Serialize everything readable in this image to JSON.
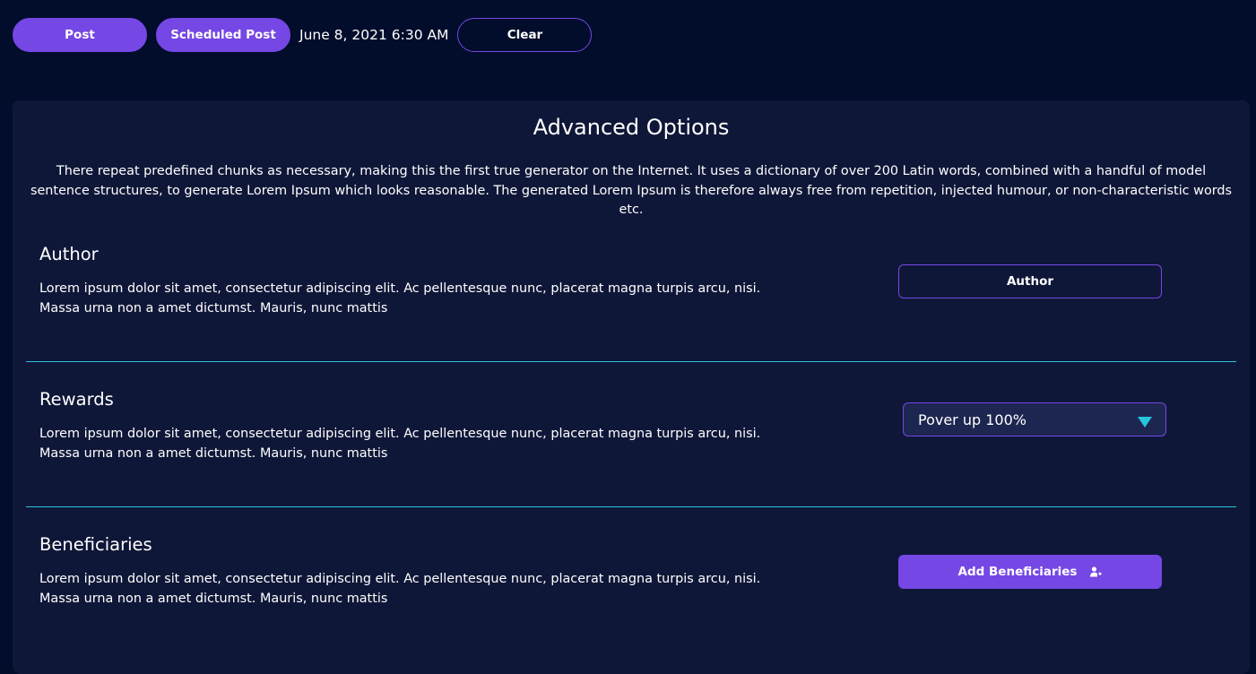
{
  "toolbar": {
    "post_label": "Post",
    "scheduled_label": "Scheduled Post",
    "datetime": "June 8, 2021 6:30 AM",
    "clear_label": "Clear"
  },
  "panel": {
    "title": "Advanced Options",
    "description": "There repeat predefined chunks as necessary, making this the first true generator on the Internet. It uses a dictionary of over 200 Latin words, combined with a handful of model sentence structures, to generate Lorem Ipsum which looks reasonable. The generated Lorem Ipsum is therefore always free from repetition, injected humour, or non-characteristic words etc."
  },
  "sections": {
    "author": {
      "title": "Author",
      "text_line1": "Lorem ipsum dolor sit amet, consectetur adipiscing elit. Ac pellentesque nunc, placerat magna turpis arcu, nisi.",
      "text_line2": "Massa urna non a amet dictumst. Mauris, nunc mattis",
      "button_label": "Author"
    },
    "rewards": {
      "title": "Rewards",
      "text_line1": "Lorem ipsum dolor sit amet, consectetur adipiscing elit. Ac pellentesque nunc, placerat magna turpis arcu, nisi.",
      "text_line2": "Massa urna non a amet dictumst. Mauris, nunc mattis",
      "select_value": "Pover up 100%"
    },
    "beneficiaries": {
      "title": "Beneficiaries",
      "text_line1": "Lorem ipsum dolor sit amet, consectetur adipiscing elit. Ac pellentesque nunc, placerat magna turpis arcu, nisi.",
      "text_line2": "Massa urna non a amet dictumst. Mauris, nunc mattis",
      "button_label": "Add Beneficiaries",
      "button_icon": "add-user-icon"
    }
  },
  "colors": {
    "background": "#020d2b",
    "panel": "#0f1738",
    "accent": "#7547e4",
    "divider": "#27c6dc",
    "select_bg": "#1c2650"
  }
}
